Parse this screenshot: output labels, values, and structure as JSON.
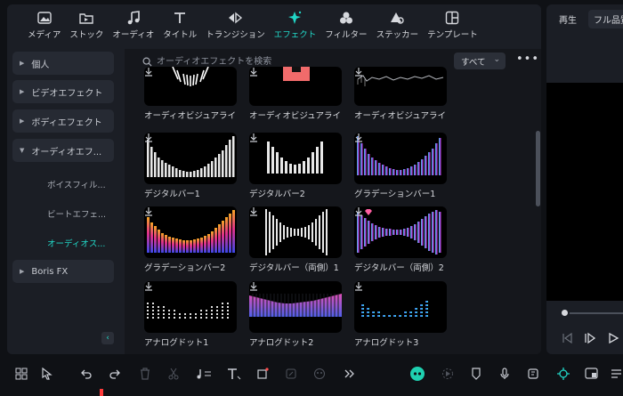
{
  "colors": {
    "accent": "#21d6c6",
    "panel": "#1b1e25",
    "content": "#15171c",
    "chip": "#262a33"
  },
  "toolbar": {
    "tabs": [
      {
        "label": "メディア",
        "icon": "media-icon"
      },
      {
        "label": "ストック",
        "icon": "stock-icon"
      },
      {
        "label": "オーディオ",
        "icon": "music-note-icon"
      },
      {
        "label": "タイトル",
        "icon": "title-t-icon"
      },
      {
        "label": "トランジション",
        "icon": "transition-icon"
      },
      {
        "label": "エフェクト",
        "icon": "effects-sparkle-icon",
        "active": true
      },
      {
        "label": "フィルター",
        "icon": "filter-icon"
      },
      {
        "label": "ステッカー",
        "icon": "sticker-icon"
      },
      {
        "label": "テンプレート",
        "icon": "template-icon"
      }
    ]
  },
  "sidebar": {
    "categories": [
      "個人",
      "ビデオエフェクト",
      "ボディエフェクト",
      "オーディオエフ...",
      "Boris FX"
    ],
    "subitems": [
      "ボイスフィル...",
      "ビートエフェ...",
      "オーディオス..."
    ],
    "collapse_icon": "chevron-left-icon"
  },
  "search": {
    "placeholder": "オーディオエフェクトを検索",
    "filter_value": "すべて"
  },
  "effects": [
    {
      "label": "オーディオビジュアライ..."
    },
    {
      "label": "オーディオビジュアライ..."
    },
    {
      "label": "オーディオビジュアライ..."
    },
    {
      "label": "デジタルバー1"
    },
    {
      "label": "デジタルバー2"
    },
    {
      "label": "グラデーションバー1"
    },
    {
      "label": "グラデーションバー2"
    },
    {
      "label": "デジタルバー（両側）1"
    },
    {
      "label": "デジタルバー（両側）2"
    },
    {
      "label": "アナログドット1"
    },
    {
      "label": "アナログドット2"
    },
    {
      "label": "アナログドット3"
    }
  ],
  "preview": {
    "tab_play": "再生",
    "tab_quality": "フル品質"
  },
  "timeline": {
    "tools": [
      "layout-grid-icon",
      "select-arrow-icon",
      "undo-icon",
      "redo-icon",
      "delete-icon",
      "scissors-icon",
      "audio-icon",
      "text-icon",
      "crop-icon",
      "keyframe-icon",
      "color-icon",
      "more-tools-icon",
      "ai-assistant-icon",
      "render-icon",
      "marker-icon",
      "mic-icon",
      "voiceover-icon",
      "snap-icon",
      "pip-icon",
      "playlist-icon"
    ]
  }
}
